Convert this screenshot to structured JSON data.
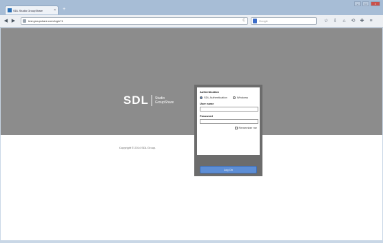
{
  "browser": {
    "tab_title": "SDL Studio GroupShare",
    "tab_close": "×",
    "new_tab": "+",
    "window_controls": [
      "–",
      "□",
      "×"
    ],
    "back": "◀",
    "forward": "▶",
    "url": "test.groupshare.com/login?1",
    "url_reload": "C",
    "search_placeholder": "Google",
    "toolbar_icons": [
      "star-icon",
      "download-icon",
      "home-icon",
      "history-icon",
      "addon-icon",
      "menu-icon"
    ],
    "toolbar_glyphs": [
      "☆",
      "⇩",
      "⌂",
      "⟲",
      "✚",
      "≡"
    ]
  },
  "page": {
    "logo_mark": "SDL",
    "logo_line1": "Studio",
    "logo_line2": "GroupShare",
    "copyright": "Copyright © 2014 SDL Group.",
    "login": {
      "heading": "Authentication",
      "option_sdl": "SDL Authentication",
      "option_windows": "Windows",
      "selected": "SDL Authentication",
      "username_label": "User name",
      "username_value": "",
      "password_label": "Password",
      "password_value": "",
      "remember_label": "Remember me",
      "button_label": "Log On"
    }
  },
  "colors": {
    "hero": "#8c8c8c",
    "login_frame": "#6c6c6c",
    "button": "#5d8ed6"
  }
}
